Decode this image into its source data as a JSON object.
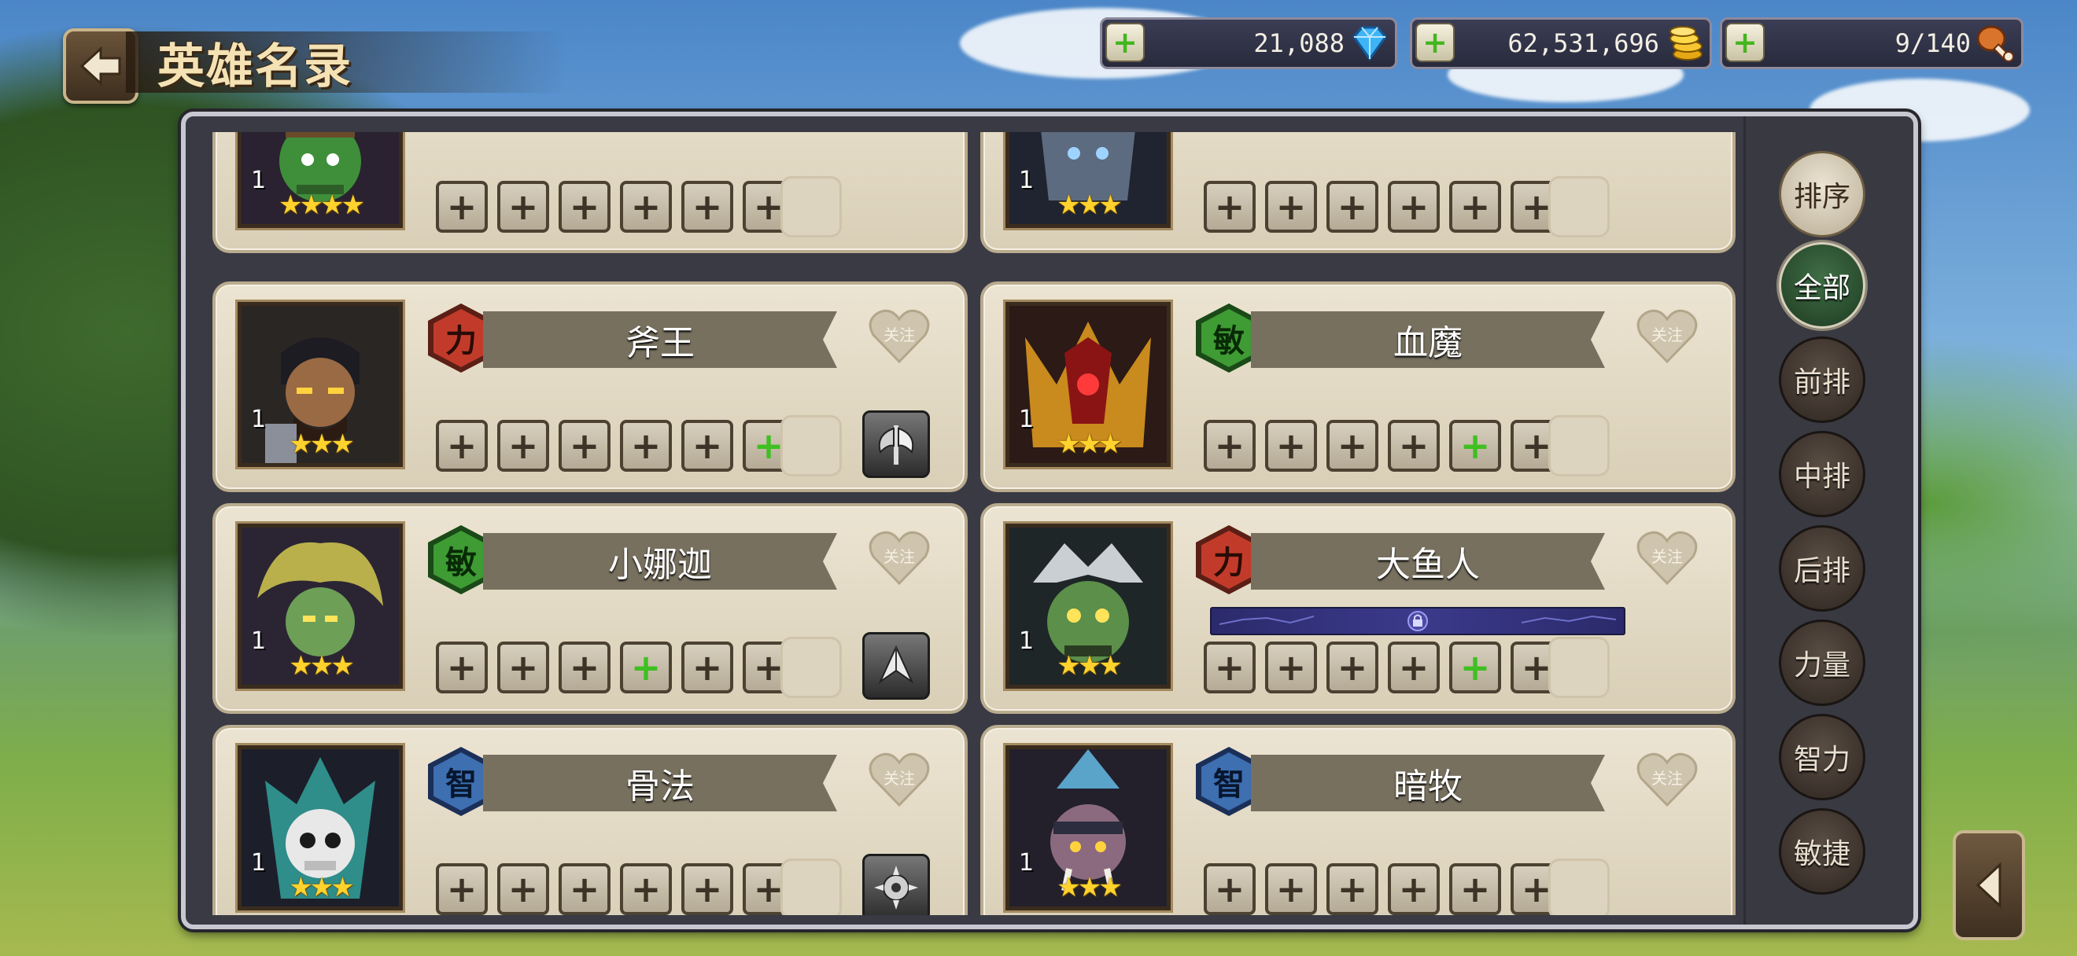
{
  "header": {
    "title": "英雄名录",
    "back": "back-arrow-icon"
  },
  "resources": [
    {
      "name": "diamond",
      "value": "21,088",
      "icon": "diamond-icon"
    },
    {
      "name": "gold",
      "value": "62,531,696",
      "icon": "gold-coins-icon"
    },
    {
      "name": "stamina",
      "value": "9/140",
      "icon": "meat-drumstick-icon"
    }
  ],
  "colors": {
    "str": "#c23b2a",
    "agi": "#3f9b34",
    "int": "#3d6fb1",
    "plus_green": "#3fbf22"
  },
  "follow_label": "关注",
  "heroes": [
    {
      "name": "",
      "attr": "",
      "level": "1",
      "stars": "★★★★",
      "green_slot": -1,
      "equip": ""
    },
    {
      "name": "",
      "attr": "",
      "level": "1",
      "stars": "★★★",
      "green_slot": -1,
      "equip": ""
    },
    {
      "name": "斧王",
      "attr": "力",
      "level": "1",
      "stars": "★★★",
      "green_slot": 5,
      "equip": "axe-icon"
    },
    {
      "name": "血魔",
      "attr": "敏",
      "level": "1",
      "stars": "★★★",
      "green_slot": 4,
      "equip": ""
    },
    {
      "name": "小娜迦",
      "attr": "敏",
      "level": "1",
      "stars": "★★★",
      "green_slot": 3,
      "equip": "claw-blade-icon"
    },
    {
      "name": "大鱼人",
      "attr": "力",
      "level": "1",
      "stars": "★★★",
      "green_slot": 4,
      "equip": "",
      "locked_bar": true
    },
    {
      "name": "骨法",
      "attr": "智",
      "level": "1",
      "stars": "★★★",
      "green_slot": -1,
      "equip": "spiked-wheel-icon"
    },
    {
      "name": "暗牧",
      "attr": "智",
      "level": "1",
      "stars": "★★★",
      "green_slot": -1,
      "equip": ""
    }
  ],
  "sidebar": {
    "sort": "排序",
    "all": "全部",
    "front": "前排",
    "middle": "中排",
    "back": "后排",
    "strength": "力量",
    "intellect": "智力",
    "agility": "敏捷"
  }
}
